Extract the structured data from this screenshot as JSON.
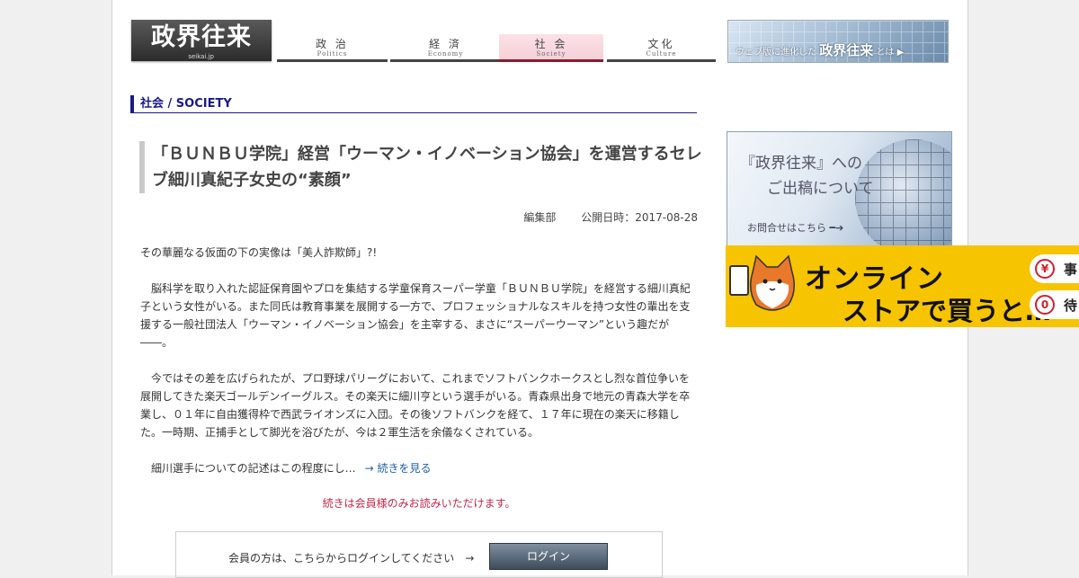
{
  "header": {
    "logo_text": "政界往来",
    "logo_sub": "seikai.jp",
    "nav": [
      {
        "jp": "政 治",
        "en": "Politics"
      },
      {
        "jp": "経 済",
        "en": "Economy"
      },
      {
        "jp": "社 会",
        "en": "Society"
      },
      {
        "jp": "文化",
        "en": "Culture"
      }
    ],
    "banner_small": "ウェブ版に進化した",
    "banner_big": "政界往来",
    "banner_tail": "とは ▶"
  },
  "section": {
    "heading": "社会 / SOCIETY"
  },
  "article": {
    "title": "「ＢＵＮＢＵ学院」経営「ウーマン・イノベーション協会」を運営するセレブ細川真紀子女史の“素顔”",
    "author": "編集部",
    "published": "公開日時：2017-08-28",
    "lead": "その華麗なる仮面の下の実像は「美人詐欺師」?!",
    "para1": "　脳科学を取り入れた認証保育園やプロを集結する学童保育スーパー学童「ＢＵＮＢＵ学院」を経営する細川真紀子という女性がいる。また同氏は教育事業を展開する一方で、プロフェッショナルなスキルを持つ女性の輩出を支援する一般社団法人「ウーマン・イノベーション協会」を主宰する、まさに“スーパーウーマン”という趣だが――。",
    "para2": "　今ではその差を広げられたが、プロ野球パリーグにおいて、これまでソフトバンクホークスとし烈な首位争いを展開してきた楽天ゴールデンイーグルス。その楽天に細川亨という選手がいる。青森県出身で地元の青森大学を卒業し、０１年に自由獲得枠で西武ライオンズに入団。その後ソフトバンクを経て、１７年に現在の楽天に移籍した。一時期、正捕手として脚光を浴びたが、今は２軍生活を余儀なくされている。",
    "para3": "　細川選手についての記述はこの程度にし…",
    "read_more": "→ 続きを見る",
    "member_note": "続きは会員様のみお読みいただけます。",
    "login_label": "会員の方は、こちらからログインしてください　→",
    "login_button": "ログイン"
  },
  "sidebar": {
    "banner_line1": "『政界往来』への",
    "banner_line2": "ご出稿について",
    "banner_line3": "お問合せはこちら ━➔"
  },
  "ad": {
    "line1": "オンライン",
    "line2": "ストアで買うと…",
    "pill1_text": "事",
    "pill1_icon": "¥",
    "pill2_text": "待",
    "pill2_icon": "0"
  },
  "colors": {
    "accent": "#1a1a8a",
    "active_nav": "#8a1c2c",
    "member_note": "#c0264a",
    "link": "#1e5fa8",
    "ad_bg": "#f6c400"
  }
}
